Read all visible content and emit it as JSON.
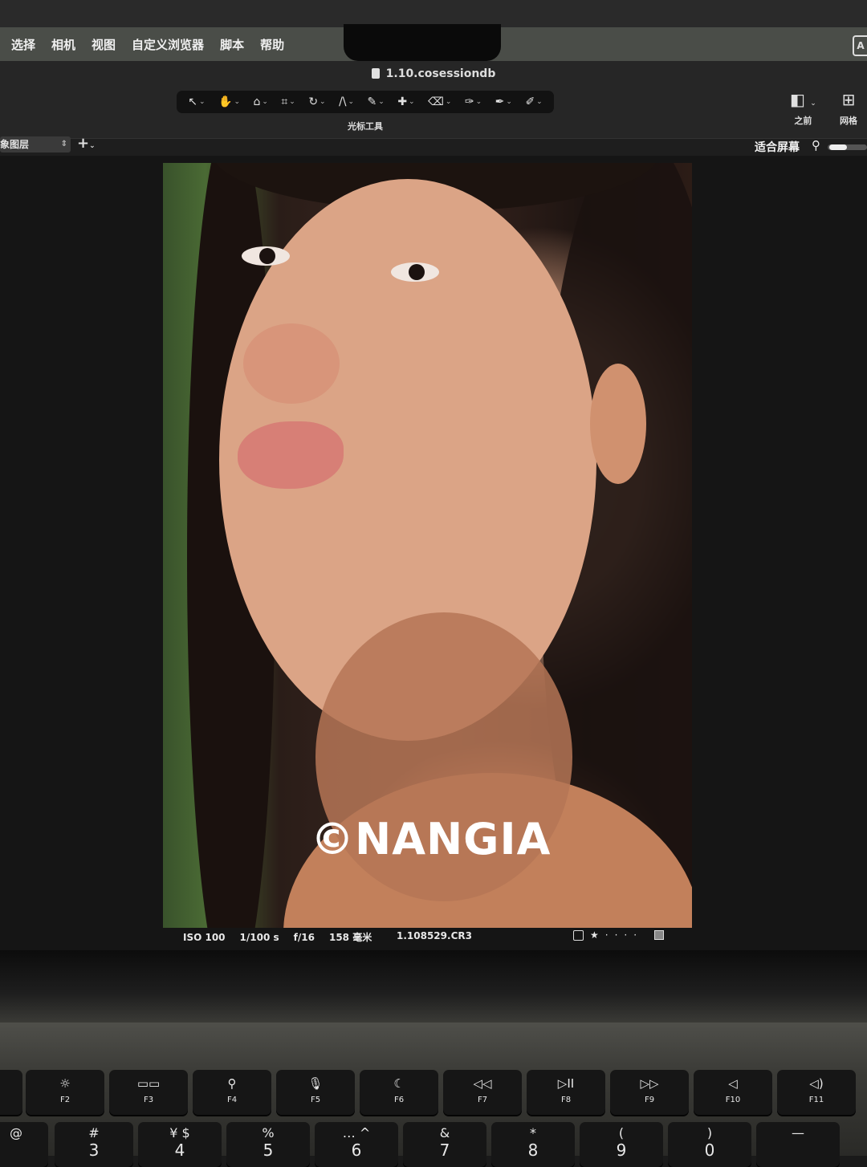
{
  "menubar": {
    "items": [
      "选择",
      "相机",
      "视图",
      "自定义浏览器",
      "脚本",
      "帮助"
    ],
    "right_glyph": "A"
  },
  "window": {
    "title": "1.10.cosessiondb"
  },
  "toolbar": {
    "group_label": "光标工具",
    "tools": [
      {
        "icon": "pointer-icon",
        "glyph": "↖"
      },
      {
        "icon": "hand-icon",
        "glyph": "✋"
      },
      {
        "icon": "loupe-icon",
        "glyph": "⌂"
      },
      {
        "icon": "crop-icon",
        "glyph": "⌗"
      },
      {
        "icon": "rotate-icon",
        "glyph": "↻"
      },
      {
        "icon": "keystone-icon",
        "glyph": "/\\"
      },
      {
        "icon": "brush-icon",
        "glyph": "✎"
      },
      {
        "icon": "heal-icon",
        "glyph": "✚"
      },
      {
        "icon": "eraser-icon",
        "glyph": "⌫"
      },
      {
        "icon": "picker-icon",
        "glyph": "✑"
      },
      {
        "icon": "wb-icon",
        "glyph": "✒"
      },
      {
        "icon": "pencil-icon",
        "glyph": "✐"
      }
    ],
    "before_label": "之前",
    "grid_label": "网格"
  },
  "layers": {
    "select_value": "象图层",
    "fit_label": "适合屏幕"
  },
  "photo": {
    "watermark": "©NANGIA"
  },
  "meta": {
    "iso": "ISO 100",
    "shutter": "1/100 s",
    "aperture": "f/16",
    "focal": "158 毫米",
    "filename": "1.108529.CR3"
  },
  "keyboard": {
    "fn_keys": [
      {
        "glyph": "☼",
        "label": "F2"
      },
      {
        "glyph": "▭▭",
        "label": "F3"
      },
      {
        "glyph": "⚲",
        "label": "F4"
      },
      {
        "glyph": "🎙",
        "label": "F5"
      },
      {
        "glyph": "☾",
        "label": "F6"
      },
      {
        "glyph": "◁◁",
        "label": "F7"
      },
      {
        "glyph": "▷II",
        "label": "F8"
      },
      {
        "glyph": "▷▷",
        "label": "F9"
      },
      {
        "glyph": "◁",
        "label": "F10"
      },
      {
        "glyph": "◁)",
        "label": "F11"
      }
    ],
    "num_keys": [
      {
        "top": "@",
        "bottom": ""
      },
      {
        "top": "#",
        "bottom": "3"
      },
      {
        "top": "¥  $",
        "bottom": "4"
      },
      {
        "top": "%",
        "bottom": "5"
      },
      {
        "top": "…  ^",
        "bottom": "6"
      },
      {
        "top": "&",
        "bottom": "7"
      },
      {
        "top": "*",
        "bottom": "8"
      },
      {
        "top": "(",
        "bottom": "9"
      },
      {
        "top": ")",
        "bottom": "0"
      },
      {
        "top": "—",
        "bottom": ""
      }
    ]
  }
}
